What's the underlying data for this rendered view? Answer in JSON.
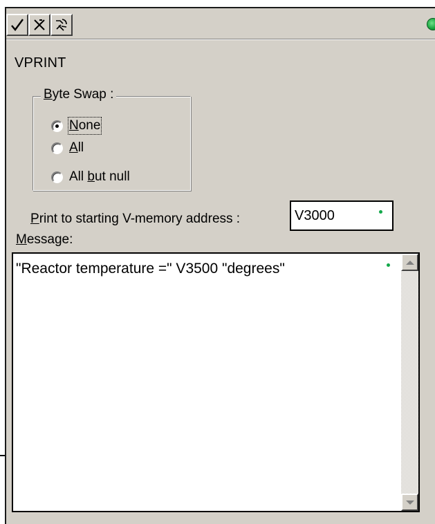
{
  "toolbar": {
    "accept_icon": "check-icon",
    "cancel_icon": "x-icon",
    "browse_icon": "browse-icon",
    "status_color": "#15a23c"
  },
  "instruction": {
    "title": "VPRINT"
  },
  "byte_swap": {
    "legend_mnemonic": "B",
    "legend_rest": "yte Swap :",
    "options": [
      {
        "mnemonic": "N",
        "rest": "one",
        "checked": true
      },
      {
        "mnemonic": "A",
        "rest": "ll",
        "checked": false
      },
      {
        "prefix": "All ",
        "mnemonic": "b",
        "rest": "ut null",
        "checked": false
      }
    ]
  },
  "address": {
    "label_mnemonic": "P",
    "label_rest": "rint to starting V-memory address :",
    "value": "V3000"
  },
  "message": {
    "label_mnemonic": "M",
    "label_rest": "essage:",
    "value": "\"Reactor temperature =\" V3500 \"degrees\""
  },
  "colors": {
    "panel": "#d4d0c8",
    "valid_dot": "#13a84a"
  }
}
